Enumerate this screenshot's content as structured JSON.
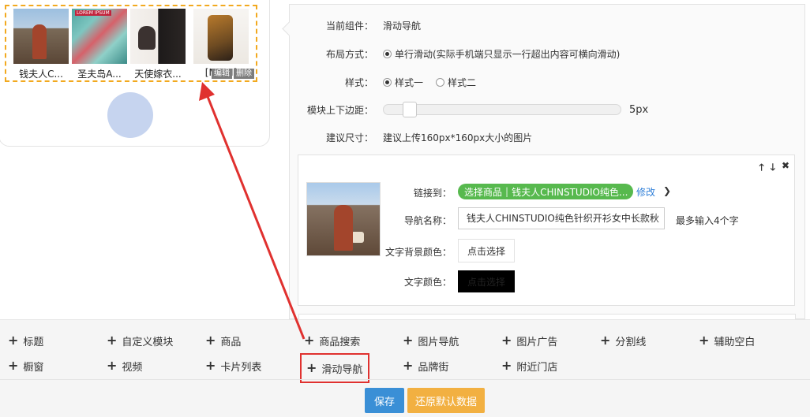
{
  "preview": {
    "items": [
      {
        "caption": "钱夫人C..."
      },
      {
        "caption": "圣夫岛A..."
      },
      {
        "caption": "天使嫁衣..."
      },
      {
        "caption": "[M:SH]"
      }
    ],
    "edit_label": "编辑",
    "delete_label": "删除"
  },
  "settings": {
    "component_label": "当前组件：",
    "component_value": "滑动导航",
    "layout_label": "布局方式：",
    "layout_option": "单行滑动(实际手机端只显示一行超出内容可横向滑动)",
    "style_label": "样式：",
    "style_option_1": "样式一",
    "style_option_2": "样式二",
    "margin_label": "模块上下边距：",
    "margin_value": "5px",
    "margin_level": 0.05,
    "size_label": "建议尺寸：",
    "size_value": "建议上传160px*160px大小的图片"
  },
  "nav_item": {
    "tool_up": "🡑",
    "tool_down": "🡓",
    "tool_close": "✖",
    "link_label": "链接到：",
    "link_type": "选择商品",
    "link_target": "钱夫人CHINSTUDIO纯色...",
    "edit_link": "修改",
    "name_label": "导航名称：",
    "name_value": "钱夫人CHINSTUDIO纯色针织开衫女中长款秋",
    "name_hint": "最多输入4个字",
    "bg_color_label": "文字背景颜色：",
    "bg_color_button": "点击选择",
    "text_color_label": "文字颜色：",
    "text_color_button": "点击选择"
  },
  "components": {
    "row1": [
      "标题",
      "自定义模块",
      "商品",
      "商品搜索",
      "图片导航",
      "图片广告",
      "分割线",
      "辅助空白"
    ],
    "row2": [
      "橱窗",
      "视频",
      "卡片列表",
      "滑动导航",
      "品牌街",
      "附近门店"
    ]
  },
  "actions": {
    "save": "保存",
    "reset": "还原默认数据"
  },
  "colors": {
    "accent_green": "#57b94e",
    "save_blue": "#3a8fd6",
    "reset_orange": "#f2b041",
    "highlight_red": "#e0312f",
    "dashed_orange": "#f2a91f"
  }
}
